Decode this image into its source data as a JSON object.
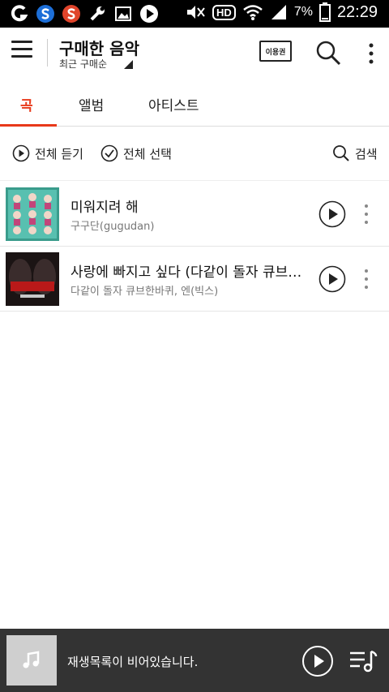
{
  "status_bar": {
    "time": "22:29",
    "battery": "7%",
    "hd": "HD"
  },
  "header": {
    "title": "구매한 음악",
    "sort_label": "최근 구매순",
    "pass_label": "이용권"
  },
  "tabs": [
    {
      "label": "곡",
      "active": true
    },
    {
      "label": "앨범",
      "active": false
    },
    {
      "label": "아티스트",
      "active": false
    }
  ],
  "actions": {
    "play_all": "전체 듣기",
    "select_all": "전체 선택",
    "search": "검색"
  },
  "songs": [
    {
      "title": "미워지려 해",
      "artist": "구구단(gugudan)"
    },
    {
      "title": "사랑에 빠지고 싶다 (다같이 돌자 큐브한바퀴)",
      "artist": "다같이 돌자 큐브한바퀴, 엔(빅스)"
    }
  ],
  "player": {
    "status_text": "재생목록이 비어있습니다."
  },
  "colors": {
    "accent": "#e8391a",
    "player_bg": "#333333"
  }
}
